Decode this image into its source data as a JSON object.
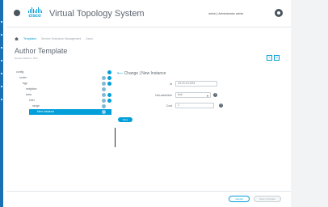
{
  "header": {
    "app_title": "Virtual Topology System",
    "logo_text": "cisco",
    "user_label": "admin | Administrator admin"
  },
  "breadcrumb": {
    "items": [
      "Templates",
      "Service Extension Management",
      "Used"
    ]
  },
  "page": {
    "title": "Author Template",
    "subtitle": "Device Platform: NFV"
  },
  "view_toggle": {
    "left": "S",
    "right": "M"
  },
  "tree": {
    "items": [
      {
        "label": "config",
        "selected": false
      },
      {
        "label": "router",
        "selected": false
      },
      {
        "label": "bgp",
        "selected": false
      },
      {
        "label": "neighbor",
        "selected": false
      },
      {
        "label": "area",
        "selected": false
      },
      {
        "label": "Inter",
        "selected": false
      },
      {
        "label": "range",
        "selected": false
      },
      {
        "label": "New Instance",
        "selected": true
      }
    ],
    "save_button": "Save"
  },
  "form": {
    "heading": "Change | New Instance",
    "fields": {
      "id_label": "Id",
      "id_value": "10.10.10.0/24",
      "not_advertise_label": "Not-advertise",
      "not_advertise_value": "true",
      "cost_label": "Cost",
      "cost_value": "1"
    }
  },
  "footer": {
    "cancel_label": "Cancel",
    "save_label": "Save Template"
  },
  "colors": {
    "accent": "#049fd9",
    "side_strip": "#1b6fb3"
  }
}
